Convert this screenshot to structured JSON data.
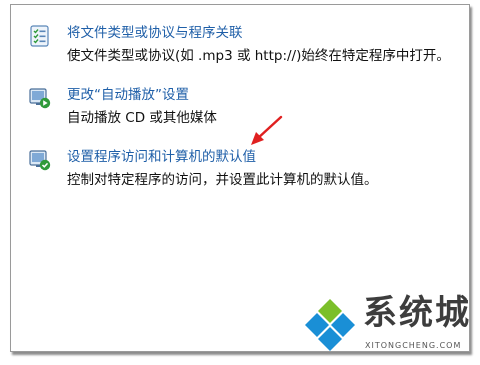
{
  "items": [
    {
      "icon": "file-type-list-icon",
      "link": "将文件类型或协议与程序关联",
      "desc": "使文件类型或协议(如 .mp3 或 http://)始终在特定程序中打开。"
    },
    {
      "icon": "autoplay-icon",
      "link": "更改“自动播放”设置",
      "desc": "自动播放 CD 或其他媒体"
    },
    {
      "icon": "default-programs-icon",
      "link": "设置程序访问和计算机的默认值",
      "desc": "控制对特定程序的访问，并设置此计算机的默认值。"
    }
  ],
  "watermark": {
    "cn": "系统城",
    "en": "XITONGCHENG.COM"
  },
  "colors": {
    "link": "#1f5fa8",
    "arrow": "#e02020",
    "logo_blue": "#1a8fd6",
    "logo_green": "#7bbf2a"
  }
}
